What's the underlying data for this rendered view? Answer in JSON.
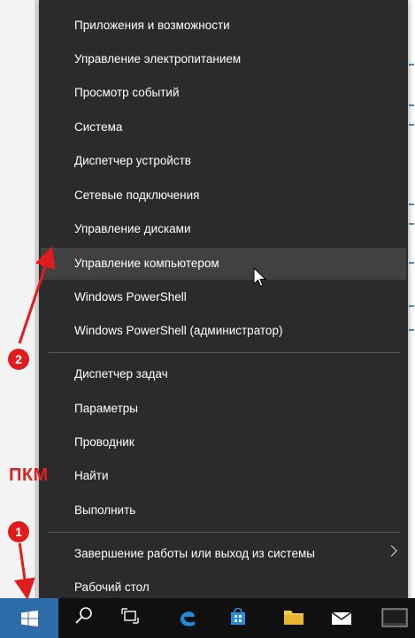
{
  "menu": {
    "items": [
      {
        "label": "Приложения и возможности"
      },
      {
        "label": "Управление электропитанием"
      },
      {
        "label": "Просмотр событий"
      },
      {
        "label": "Система"
      },
      {
        "label": "Диспетчер устройств"
      },
      {
        "label": "Сетевые подключения"
      },
      {
        "label": "Управление дисками"
      },
      {
        "label": "Управление компьютером",
        "highlighted": true
      },
      {
        "label": "Windows PowerShell"
      },
      {
        "label": "Windows PowerShell (администратор)"
      },
      {
        "label": "Диспетчер задач"
      },
      {
        "label": "Параметры"
      },
      {
        "label": "Проводник"
      },
      {
        "label": "Найти"
      },
      {
        "label": "Выполнить"
      },
      {
        "label": "Завершение работы или выход из системы",
        "has_submenu": true
      },
      {
        "label": "Рабочий стол"
      }
    ]
  },
  "annotations": {
    "pkm_label": "ПКМ",
    "step1": "1",
    "step2": "2"
  },
  "taskbar": {
    "icons": [
      "windows-start-icon",
      "search-icon",
      "task-view-icon",
      "edge-icon",
      "store-icon",
      "folder-icon",
      "mail-icon",
      "desktop-icon"
    ]
  },
  "colors": {
    "menu_bg": "#2b2b2b",
    "menu_hover": "#414141",
    "annotation_red": "#e21c1c",
    "start_blue": "#2d6ca8"
  }
}
